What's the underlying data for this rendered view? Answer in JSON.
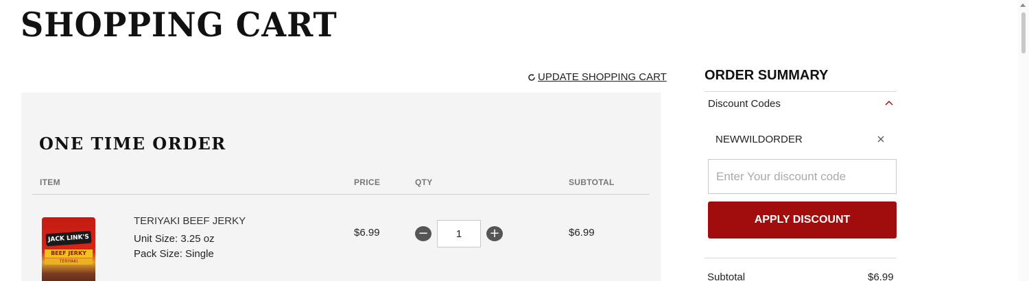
{
  "page_title": "SHOPPING CART",
  "update_cart_label": " UPDATE SHOPPING CART",
  "cart": {
    "section_title": "ONE TIME ORDER",
    "columns": {
      "item": "ITEM",
      "price": "PRICE",
      "qty": "QTY",
      "subtotal": "SUBTOTAL"
    },
    "items": [
      {
        "name": "TERIYAKI BEEF JERKY",
        "unit_size_label": "Unit Size:",
        "unit_size": "3.25 oz",
        "pack_size_label": "Pack Size:",
        "pack_size": "Single",
        "price": "$6.99",
        "qty": "1",
        "subtotal": "$6.99",
        "image_brand": "JACK LINK'S",
        "image_band": "BEEF JERKY",
        "image_flavor": "TERIYAKI"
      }
    ]
  },
  "summary": {
    "title": "ORDER SUMMARY",
    "discount_toggle": "Discount Codes",
    "applied_code": "NEWWILDORDER",
    "discount_placeholder": "Enter Your discount code",
    "apply_label": "APPLY DISCOUNT",
    "subtotal_label": "Subtotal",
    "subtotal_value": "$6.99"
  },
  "colors": {
    "accent": "#a10c0c",
    "panel_bg": "#f4f4f4"
  },
  "icons": {
    "update": "refresh-icon",
    "toggle": "chevron-up-icon",
    "remove": "close-icon",
    "minus": "minus-icon",
    "plus": "plus-icon"
  }
}
